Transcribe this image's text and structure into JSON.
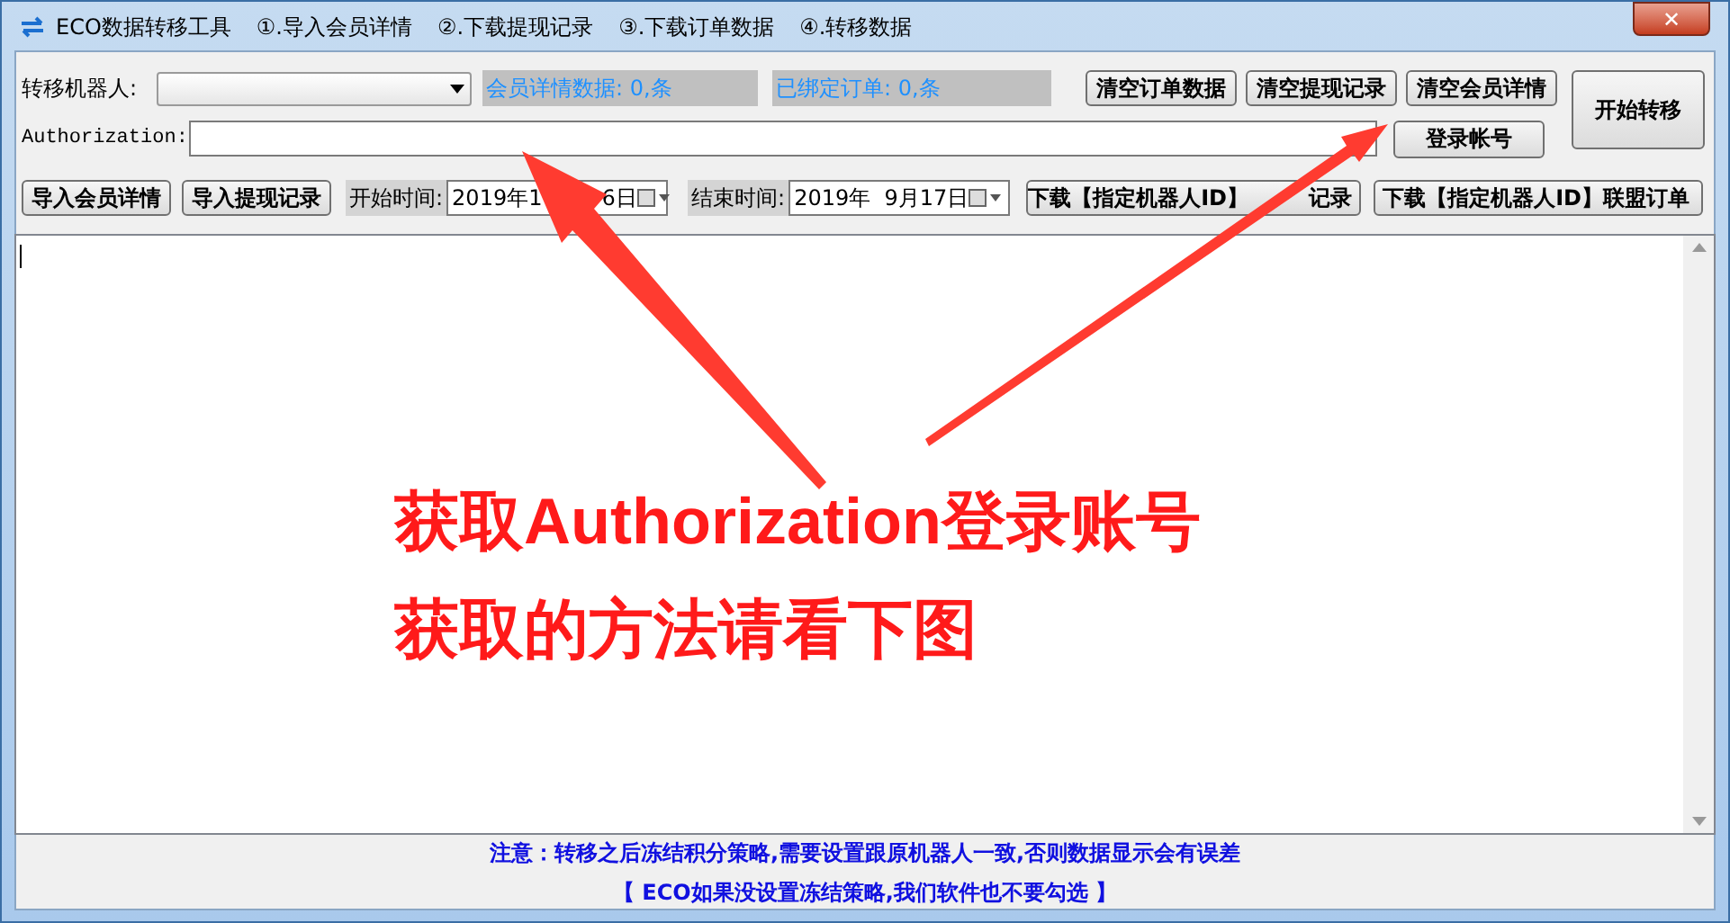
{
  "window": {
    "title": "ECO数据转移工具",
    "close": "✕"
  },
  "menu": [
    {
      "label": "①.导入会员详情"
    },
    {
      "label": "②.下载提现记录"
    },
    {
      "label": "③.下载订单数据"
    },
    {
      "label": "④.转移数据"
    }
  ],
  "robot": {
    "label": "转移机器人:"
  },
  "stats": [
    {
      "text": "会员详情数据: 0,条"
    },
    {
      "text": "已绑定订单: 0,条"
    }
  ],
  "clear_buttons": [
    "清空订单数据",
    "清空提现记录",
    "清空会员详情"
  ],
  "start_button": "开始转移",
  "authorization": {
    "label": "Authorization:"
  },
  "login_button": "登录帐号",
  "import_buttons": [
    "导入会员详情",
    "导入提现记录"
  ],
  "start_time": {
    "label": "开始时间:",
    "value_parts": [
      "2019年1",
      "6日"
    ]
  },
  "end_time": {
    "label": "结束时间:",
    "value_parts": [
      "2019年  9月17日"
    ]
  },
  "download_buttons": [
    {
      "label_parts": [
        "下载【指定机器人ID】",
        "记录"
      ]
    },
    {
      "label_parts": [
        "下载【指定机器人ID】联盟订单"
      ]
    }
  ],
  "overlay_text": [
    "获取Authorization登录账号",
    "获取的方法请看下图"
  ],
  "notes": [
    "注意：转移之后冻结积分策略,需要设置跟原机器人一致,否则数据显示会有误差",
    "【 ECO如果没设置冻结策略,我们软件也不要勾选 】"
  ]
}
